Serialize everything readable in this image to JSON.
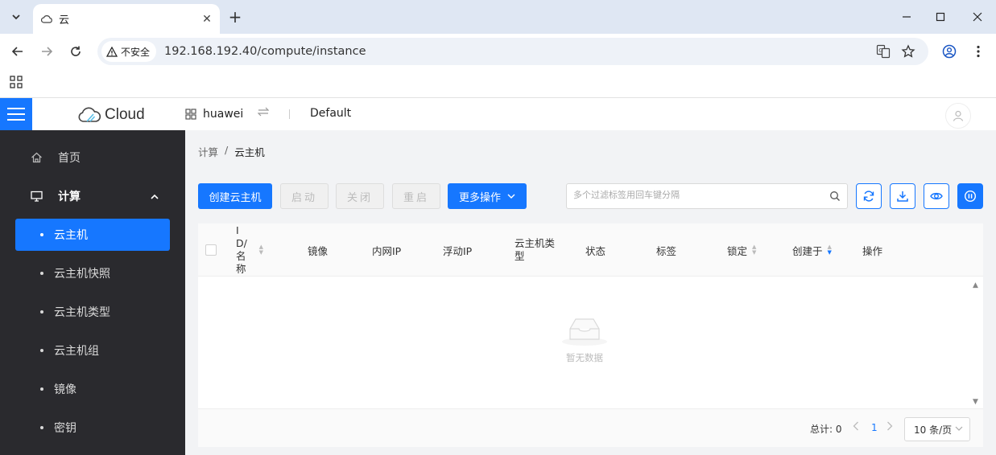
{
  "browser": {
    "tab_title": "云",
    "tab_close": "✕",
    "new_tab": "+",
    "security_label": "不安全",
    "url": "192.168.192.40/compute/instance"
  },
  "header": {
    "logo_text": "Cloud",
    "project": "huawei",
    "domain": "Default"
  },
  "sidebar": {
    "home": "首页",
    "compute": "计算",
    "items": [
      "云主机",
      "云主机快照",
      "云主机类型",
      "云主机组",
      "镜像",
      "密钥"
    ],
    "active_index": 0
  },
  "breadcrumb": {
    "parent": "计算",
    "separator": "/",
    "current": "云主机"
  },
  "actions": {
    "create": "创建云主机",
    "start": "启动",
    "stop": "关闭",
    "restart": "重启",
    "more": "更多操作"
  },
  "search": {
    "placeholder": "多个过滤标签用回车键分隔"
  },
  "table": {
    "columns": [
      "ID/名称",
      "镜像",
      "内网IP",
      "浮动IP",
      "云主机类型",
      "状态",
      "标签",
      "锁定",
      "创建于",
      "操作"
    ],
    "empty_text": "暂无数据"
  },
  "pagination": {
    "total_label": "总计: ",
    "total": "0",
    "current_page": "1",
    "page_size": "10 条/页"
  },
  "colors": {
    "primary": "#1677ff",
    "sidebar_bg": "#2a2a2e"
  }
}
